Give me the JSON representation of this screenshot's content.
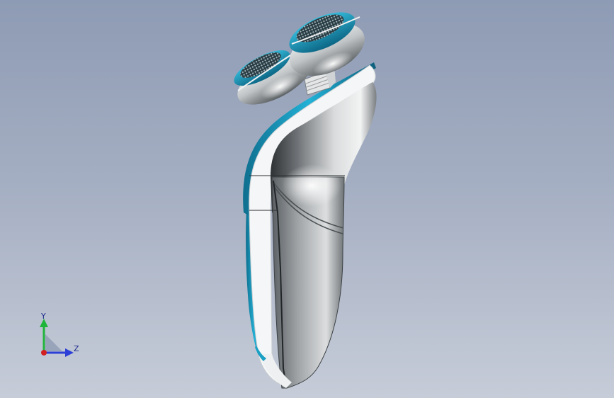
{
  "viewport": {
    "colors": {
      "background_top": "#8e9bb4",
      "background_bottom": "#c6ccd8",
      "accent_blue": "#1aa0c4",
      "body_silver": "#b9bcbf",
      "trim_white": "#f4f6f7"
    }
  },
  "model": {
    "parts": [
      "shaver-head-left",
      "shaver-head-right",
      "shaver-neck",
      "shaver-handle",
      "blue-trim",
      "white-front-panel"
    ]
  },
  "triad": {
    "y_label": "Y",
    "z_label": "Z",
    "colors": {
      "y": "#1fb43a",
      "z": "#2c3fd6",
      "x": "#d21f1f"
    }
  }
}
